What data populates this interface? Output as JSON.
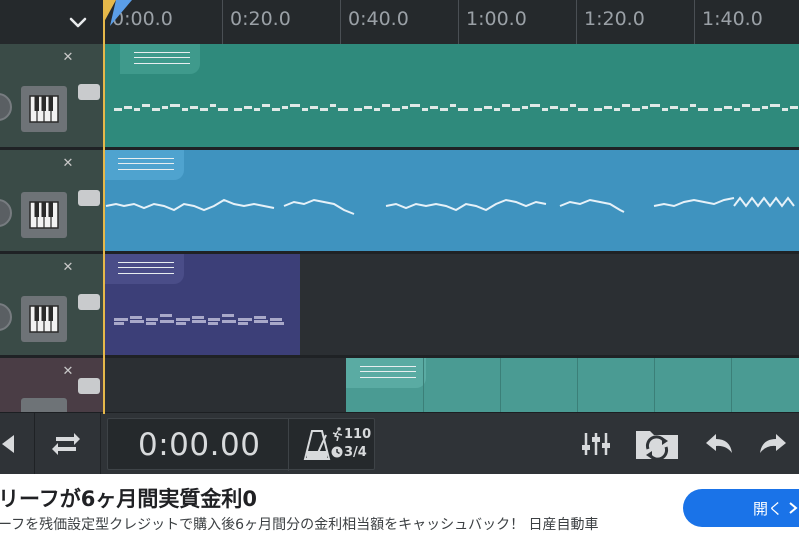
{
  "ruler": {
    "labels": [
      "0:00.0",
      "0:20.0",
      "0:40.0",
      "1:00.0",
      "1:20.0",
      "1:40.0"
    ]
  },
  "transport": {
    "time": "0:00.00",
    "bpm": "110",
    "time_signature": "3/4"
  },
  "tracks": [
    {
      "instrument": "piano",
      "clip_color": "#2f8a7c",
      "header_color": "#3a4b47"
    },
    {
      "instrument": "piano",
      "clip_color": "#3f93bf",
      "header_color": "#3a4b47"
    },
    {
      "instrument": "piano",
      "clip_color": "#3c3f78",
      "header_color": "#3a4b47"
    },
    {
      "instrument": "unknown",
      "clip_color": "#4a9b93",
      "header_color": "#4a3d45"
    }
  ],
  "ad": {
    "title": "リーフが6ヶ月間実質金利0",
    "description": "ーフを残価設定型クレジットで購入後6ヶ月間分の金利相当額をキャッシュバック！ 日産自動車",
    "cta": "開く"
  },
  "colors": {
    "accent": "#e6b84a",
    "ad_button": "#1a73e8"
  }
}
